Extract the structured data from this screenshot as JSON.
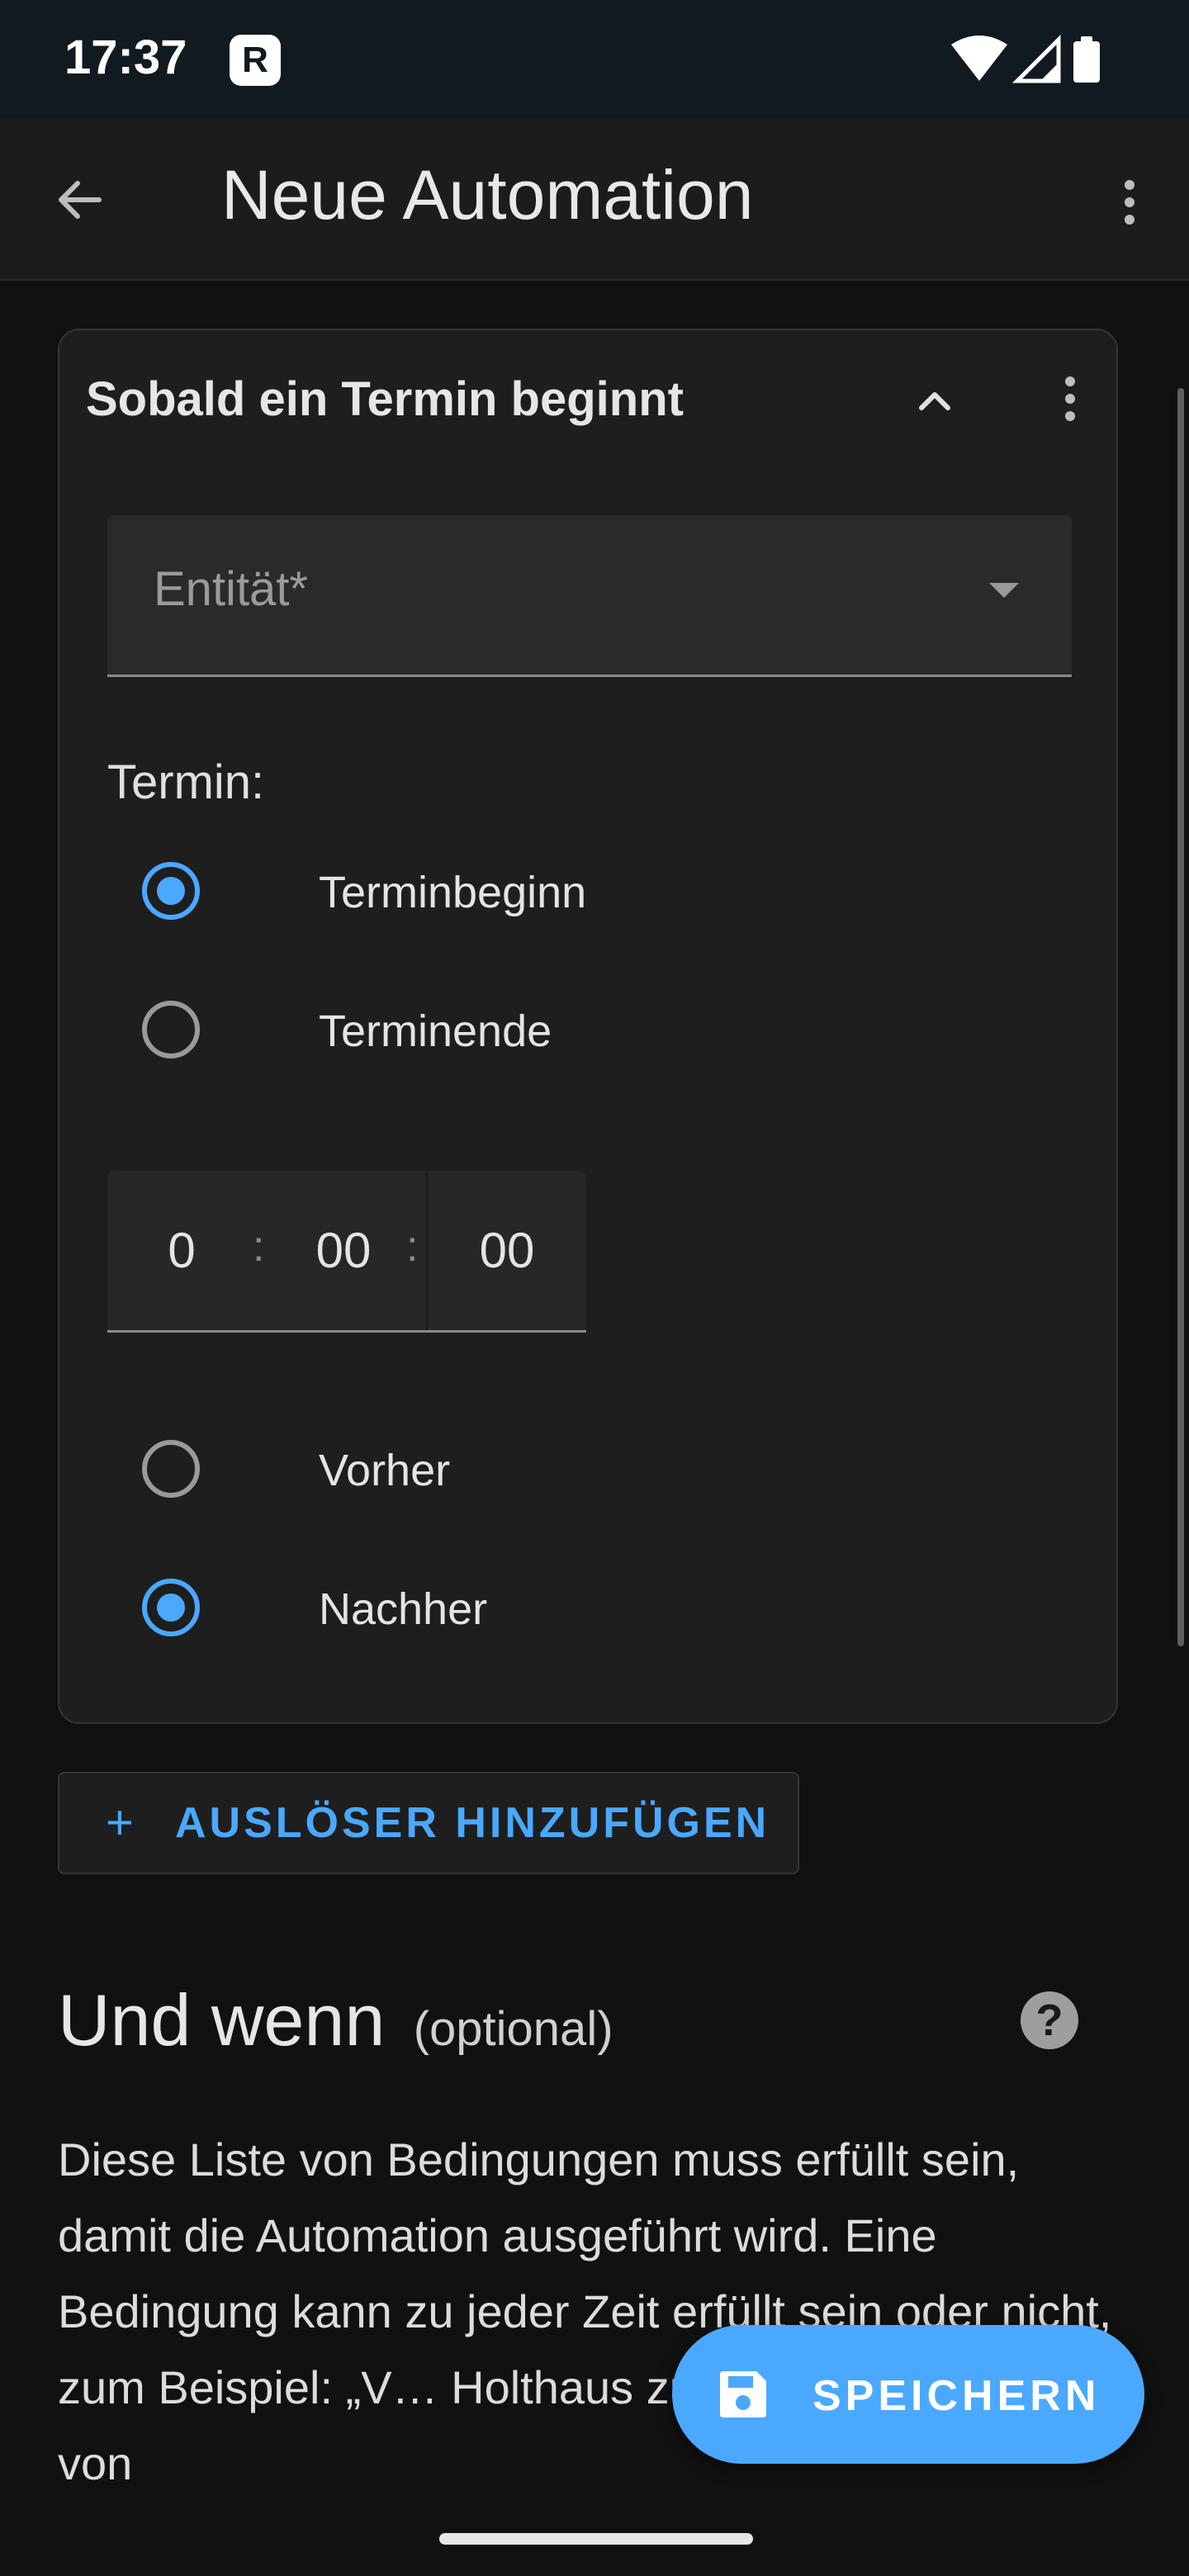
{
  "status_bar": {
    "time": "17:37",
    "app_icon": "R"
  },
  "app_bar": {
    "title": "Neue Automation"
  },
  "trigger_card": {
    "title": "Sobald ein Termin beginnt",
    "entity_label": "Entität*",
    "event_label": "Termin:",
    "event_options": [
      {
        "label": "Terminbeginn",
        "selected": true
      },
      {
        "label": "Terminende",
        "selected": false
      }
    ],
    "offset": {
      "hours": "0",
      "minutes": "00",
      "seconds": "00",
      "separator": ":"
    },
    "direction_options": [
      {
        "label": "Vorher",
        "selected": false
      },
      {
        "label": "Nachher",
        "selected": true
      }
    ]
  },
  "add_trigger": {
    "plus": "+",
    "label": "AUSLÖSER HINZUFÜGEN"
  },
  "conditions_section": {
    "title": "Und wenn",
    "optional": "(optional)",
    "help": "?",
    "description": "Diese Liste von Bedingungen muss erfüllt sein, damit die Automation ausgeführt wird. Eine Bedingung kann zu jeder Zeit erfüllt sein oder nicht, zum Beispiel: „V… Holthaus zuhause ist“. Mithilfe von"
  },
  "fab": {
    "label": "SPEICHERN"
  },
  "colors": {
    "accent": "#4aa8ff",
    "background": "#111111",
    "card": "#1e1e1e"
  }
}
